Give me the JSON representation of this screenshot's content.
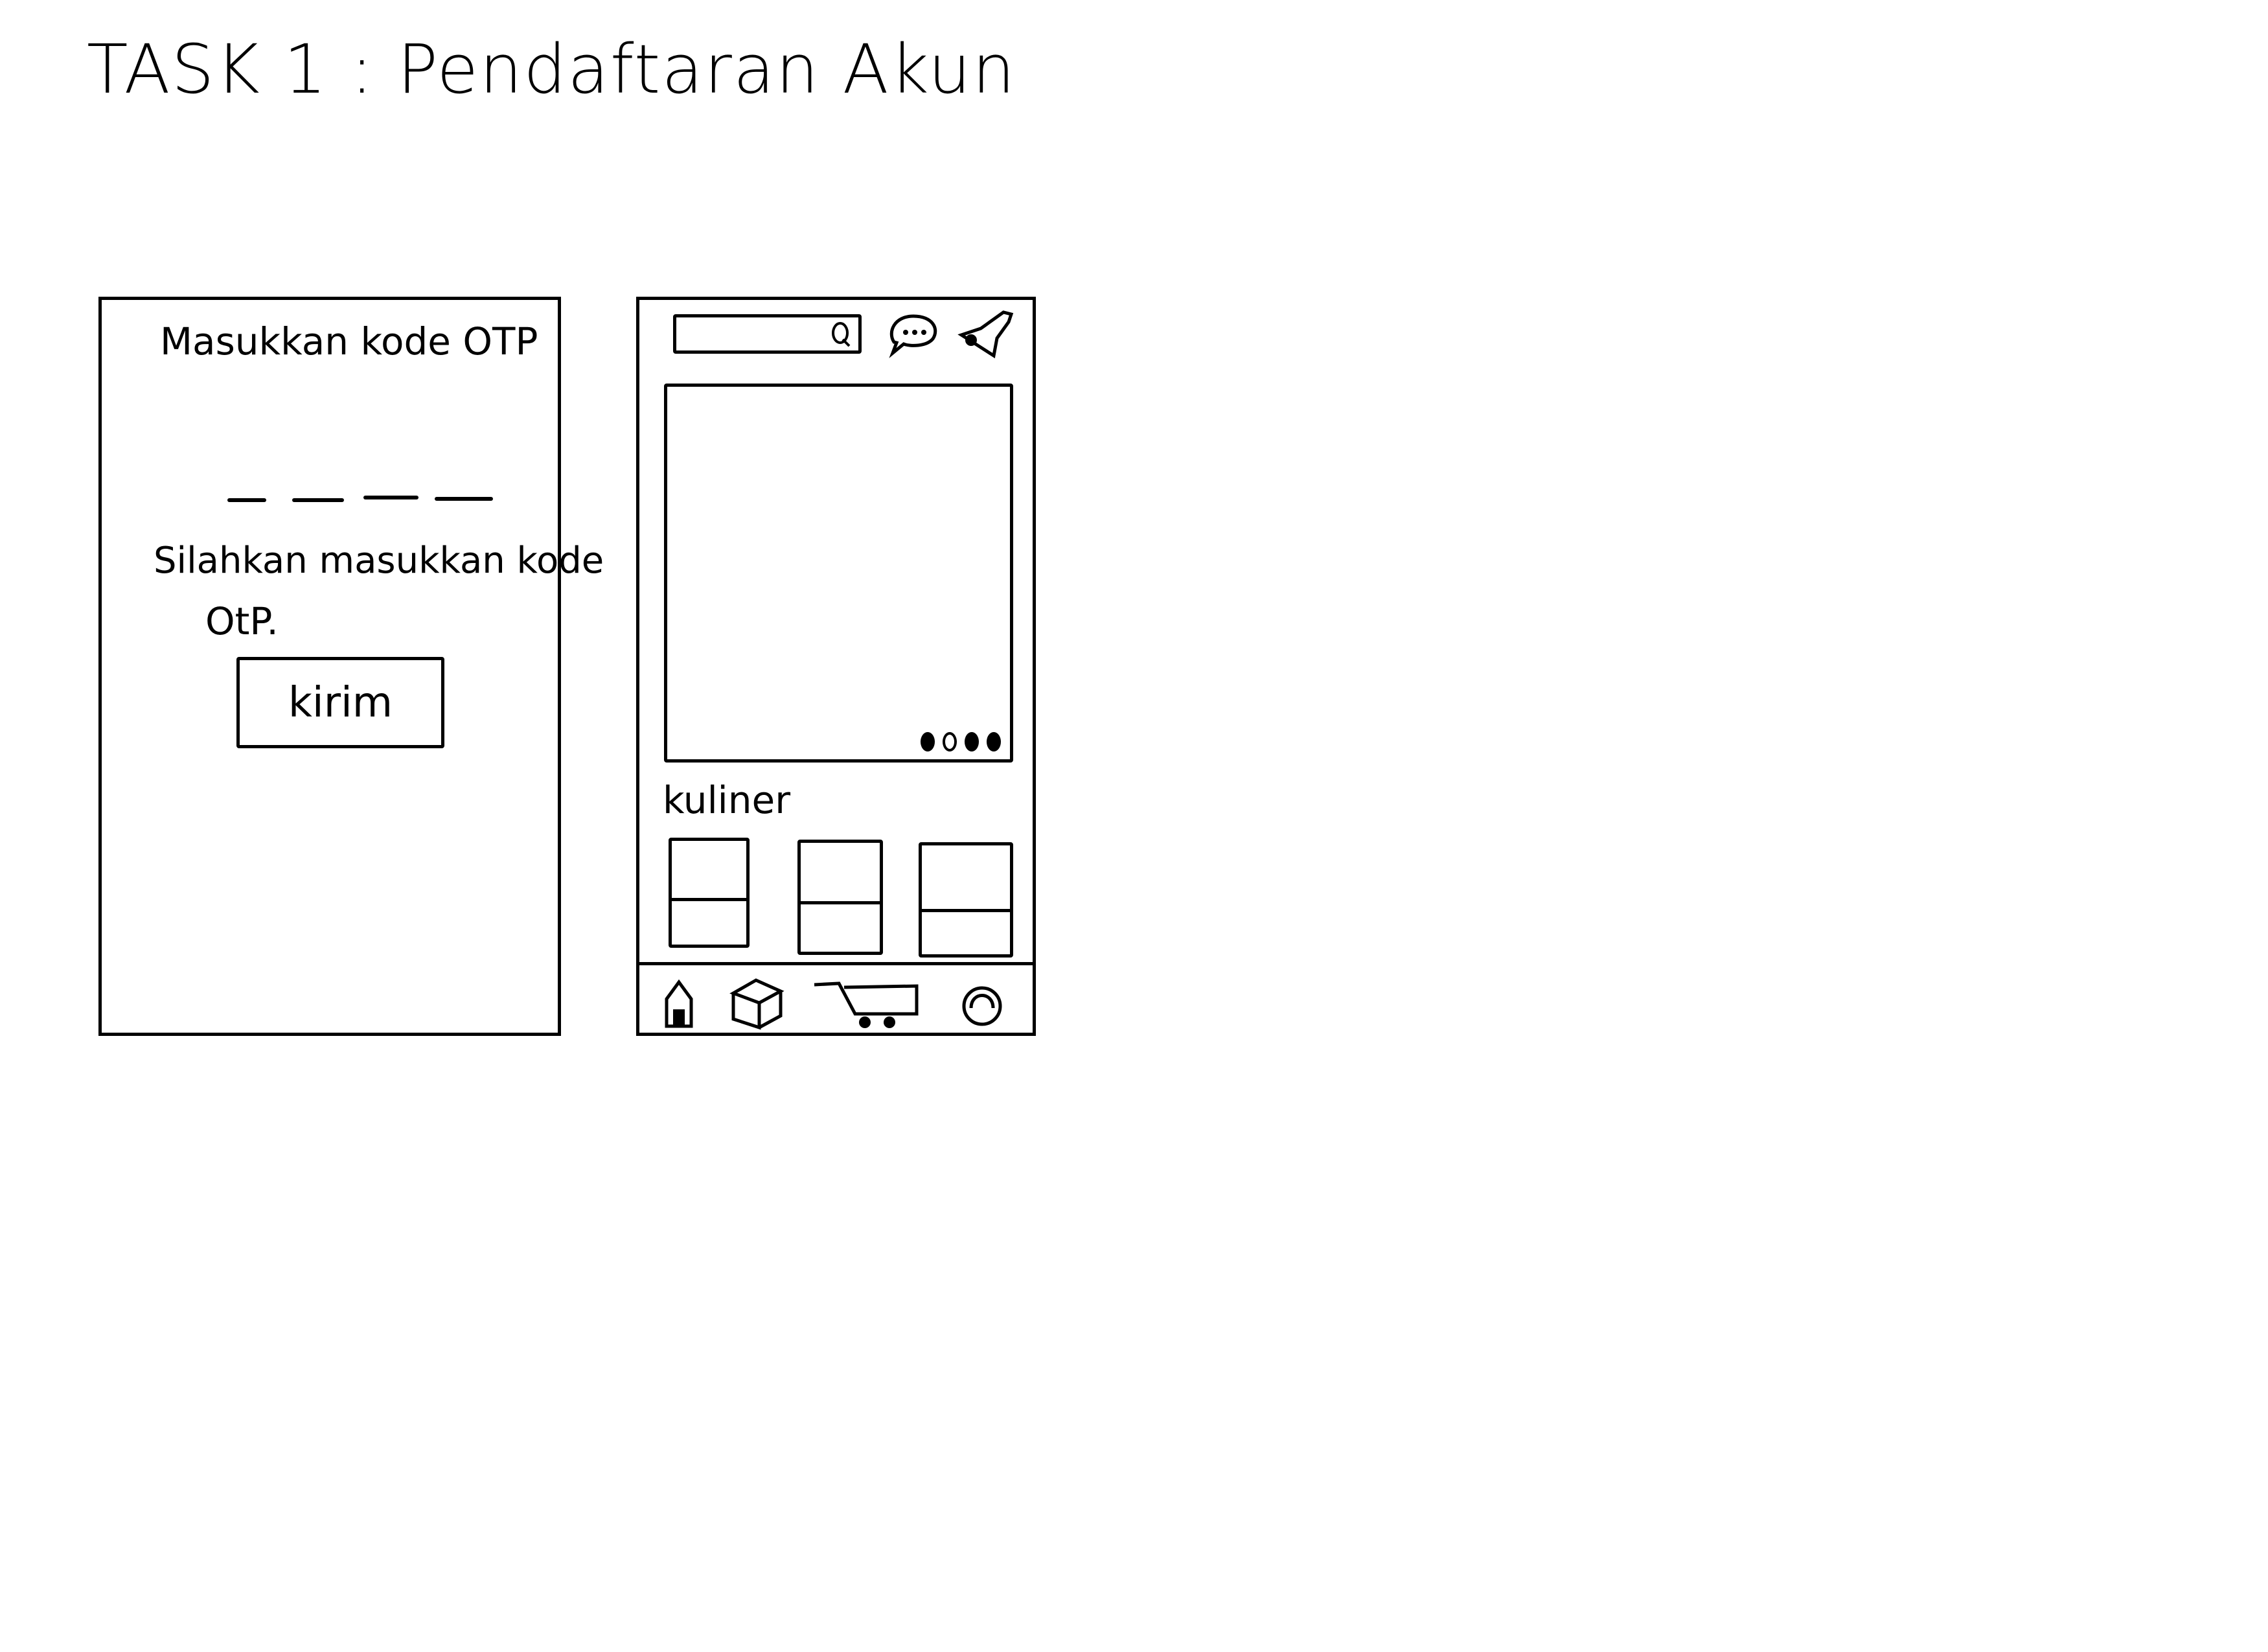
{
  "title": "TASK 1 : Pendaftaran Akun",
  "otp_screen": {
    "heading": "Masukkan kode OTP",
    "otp_slots": 4,
    "instruction_line1": "Silahkan masukkan kode",
    "instruction_line2": "OtP.",
    "submit_label": "kirim"
  },
  "home_screen": {
    "search_icon": "search-icon",
    "chat_icon": "chat-icon",
    "notification_icon": "bell-icon",
    "carousel_pages": 4,
    "carousel_active": 1,
    "section_title": "kuliner",
    "cards": 3,
    "bottom_nav": [
      "home-icon",
      "box-icon",
      "cart-icon",
      "profile-icon"
    ]
  }
}
